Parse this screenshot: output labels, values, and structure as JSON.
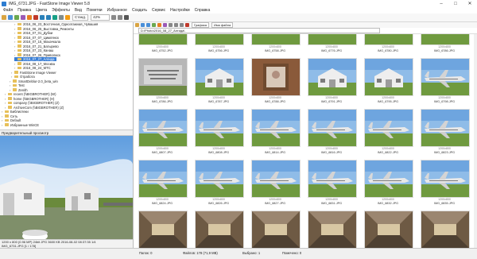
{
  "window": {
    "title": "IMG_6731.JPG - FastStone Image Viewer 5.8",
    "controls": [
      "–",
      "□",
      "✕"
    ]
  },
  "menu": [
    "Файл",
    "Правка",
    "Цвета",
    "Эффекты",
    "Вид",
    "Пометки",
    "Избранное",
    "Создать",
    "Сервис",
    "Настройки",
    "Справка"
  ],
  "toolbar": {
    "fit_label": "Станд.",
    "zoom": "42%"
  },
  "view": {
    "mode": "Графика",
    "sort": "Имя файла"
  },
  "path": "D:\\Photo\\2016_08_27_Алгида\\",
  "tree": [
    {
      "label": "2016_06_23_Восточная_Одноэтажная_Чувашия",
      "indent": 18
    },
    {
      "label": "2016_06_25_Выставка_Ремонты",
      "indent": 18
    },
    {
      "label": "2016_07_01_Дубки",
      "indent": 18
    },
    {
      "label": "2016_07_07_Цимлянск",
      "indent": 18
    },
    {
      "label": "2016_07_15_Махачкала",
      "indent": 18
    },
    {
      "label": "2016_07_21_Батырево",
      "indent": 18
    },
    {
      "label": "2016_07_23_Канаш",
      "indent": 18
    },
    {
      "label": "2016_07_26_Приволжск",
      "indent": 18
    },
    {
      "label": "2016_07_27_Алгида",
      "indent": 18,
      "selected": true
    },
    {
      "label": "2016_08_17_Москва",
      "indent": 18
    },
    {
      "label": "2016_08_24_МТС",
      "indent": 18
    },
    {
      "label": "FastStone Image Viewer",
      "indent": 14
    },
    {
      "label": "Отработа",
      "indent": 14
    },
    {
      "label": "SmartDeblur-2.0_beta_win",
      "indent": 12
    },
    {
      "label": "Test",
      "indent": 12
    },
    {
      "label": "Zenith",
      "indent": 12
    },
    {
      "label": "recent (\\\\BIGBROTHER) (W)",
      "indent": 6
    },
    {
      "label": "home (\\\\BIGBROTHER) (H)",
      "indent": 6
    },
    {
      "label": "company (\\\\BIGBROTHER) (Z)",
      "indent": 6
    },
    {
      "label": "ArchiveCom (\\\\BIGBROTHER) (Z)",
      "indent": 6
    },
    {
      "label": "Библиотеки",
      "indent": 2
    },
    {
      "label": "Сеть",
      "indent": 2
    },
    {
      "label": "Default",
      "indent": 2
    },
    {
      "label": "Избранные WinCE",
      "indent": 2
    }
  ],
  "preview": {
    "title": "Предварительный просмотр",
    "info1": "1200 x 800 (0.96 MP)  24bit  JPG  3600 KB  2016-08-02 08:37:35  1/4",
    "info2": "IMG_6731.JPG [1 / 178]"
  },
  "thumbnails": [
    {
      "dim": "1200x800",
      "name": "IMG_6752.JPG",
      "scene": "buildings"
    },
    {
      "dim": "1200x800",
      "name": "IMG_6756.JPG",
      "scene": "buildings"
    },
    {
      "dim": "1200x800",
      "name": "IMG_6758.JPG",
      "scene": "buildings"
    },
    {
      "dim": "1200x800",
      "name": "IMG_6776.JPG",
      "scene": "buildings"
    },
    {
      "dim": "1200x800",
      "name": "IMG_6780.JPG",
      "scene": "buildings"
    },
    {
      "dim": "1200x800",
      "name": "IMG_6786.JPG",
      "scene": "buildings"
    },
    {
      "dim": "1200x800",
      "name": "IMG_6786.JPG",
      "scene": "stone"
    },
    {
      "dim": "1200x800",
      "name": "IMG_6787.JPG",
      "scene": "house"
    },
    {
      "dim": "1200x800",
      "name": "IMG_6788.JPG",
      "scene": "window"
    },
    {
      "dim": "1200x800",
      "name": "IMG_6791.JPG",
      "scene": "house"
    },
    {
      "dim": "1200x800",
      "name": "IMG_6795.JPG",
      "scene": "house"
    },
    {
      "dim": "1200x800",
      "name": "IMG_6798.JPG",
      "scene": "plane"
    },
    {
      "dim": "1200x800",
      "name": "IMG_6807.JPG",
      "scene": "plane"
    },
    {
      "dim": "1200x800",
      "name": "IMG_6808.JPG",
      "scene": "plane"
    },
    {
      "dim": "1200x800",
      "name": "IMG_6814.JPG",
      "scene": "plane"
    },
    {
      "dim": "1200x800",
      "name": "IMG_6816.JPG",
      "scene": "plane"
    },
    {
      "dim": "1200x800",
      "name": "IMG_6822.JPG",
      "scene": "plane"
    },
    {
      "dim": "1200x800",
      "name": "IMG_6823.JPG",
      "scene": "plane"
    },
    {
      "dim": "1200x800",
      "name": "IMG_6824.JPG",
      "scene": "plane"
    },
    {
      "dim": "1200x800",
      "name": "IMG_6826.JPG",
      "scene": "plane"
    },
    {
      "dim": "1200x800",
      "name": "IMG_6827.JPG",
      "scene": "plane"
    },
    {
      "dim": "1200x800",
      "name": "IMG_6831.JPG",
      "scene": "plane"
    },
    {
      "dim": "1200x800",
      "name": "IMG_6832.JPG",
      "scene": "plane"
    },
    {
      "dim": "1200x800",
      "name": "IMG_6835.JPG",
      "scene": "plane"
    },
    {
      "dim": "1200x800",
      "name": "",
      "scene": "interior"
    },
    {
      "dim": "1200x800",
      "name": "",
      "scene": "interior"
    },
    {
      "dim": "1200x800",
      "name": "",
      "scene": "interior"
    },
    {
      "dim": "1200x800",
      "name": "",
      "scene": "interior"
    },
    {
      "dim": "1200x800",
      "name": "",
      "scene": "interior"
    },
    {
      "dim": "1200x800",
      "name": "",
      "scene": "interior"
    }
  ],
  "status": {
    "folders": "Папок: 0",
    "files": "Файлов: 178 (71,9 MB)",
    "selected": "Выбрано: 1",
    "marked": "Помечено: 0"
  },
  "colors": {
    "selection": "#3a7fd6",
    "folder": "#e7c05a"
  }
}
